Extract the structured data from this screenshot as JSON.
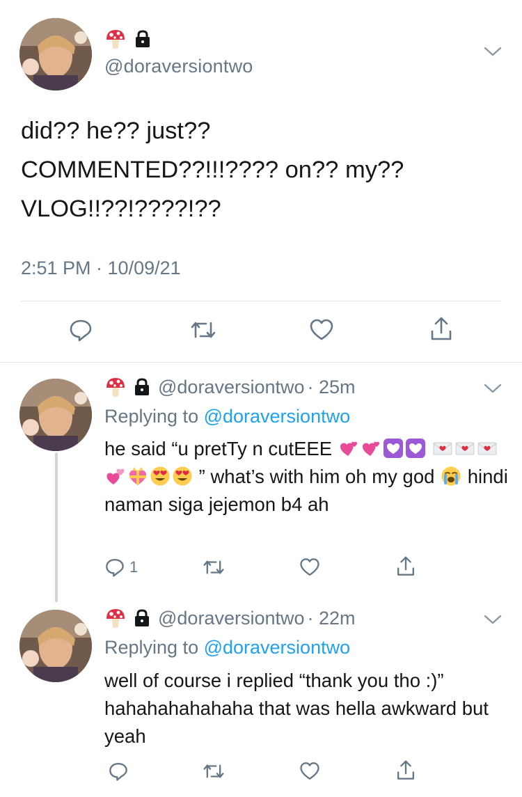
{
  "main_tweet": {
    "handle": "@doraversiontwo",
    "text": "did?? he?? just??\nCOMMENTED??!!!???? on?? my??\nVLOG!!??!????!??",
    "timestamp": "2:51 PM · 10/09/21"
  },
  "replies": [
    {
      "handle": "@doraversiontwo",
      "time": "· 25m",
      "replying_prefix": "Replying to ",
      "replying_handle": "@doraversiontwo",
      "text_part1": "he said “u pretTy n cutEEE ",
      "text_part2": " ” what’s with him oh my god ",
      "text_part3": " hindi naman siga jejemon b4 ah",
      "reply_count": "1"
    },
    {
      "handle": "@doraversiontwo",
      "time": "· 22m",
      "replying_prefix": "Replying to ",
      "replying_handle": "@doraversiontwo",
      "text": "well of course i replied “thank you tho :)” hahahahahahaha that was hella awkward but yeah",
      "reply_count": ""
    }
  ],
  "icons": {
    "name_icons": [
      "mushroom-icon",
      "lock-icon"
    ],
    "actions": [
      "reply-icon",
      "retweet-icon",
      "like-icon",
      "share-icon"
    ],
    "menu": "chevron-down-icon"
  },
  "colors": {
    "text": "#14171a",
    "secondary": "#657786",
    "link": "#1da1f2",
    "divider": "#dfe3e6"
  }
}
